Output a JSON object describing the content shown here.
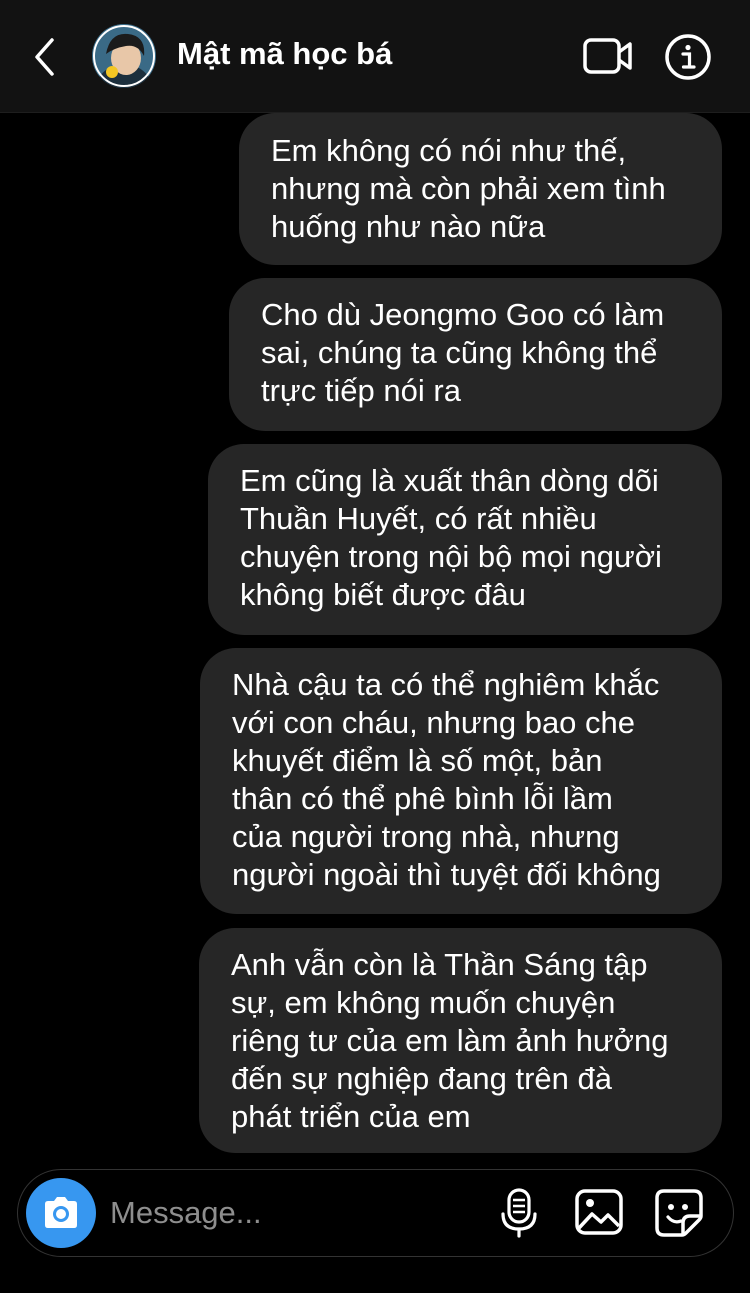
{
  "header": {
    "title": "Mật mã học bá",
    "back_icon": "chevron-left-icon",
    "video_icon": "video-camera-icon",
    "info_icon": "info-icon"
  },
  "messages": [
    {
      "text": "Em không có nói như thế,\nnhưng mà còn phải xem tình\nhuống như nào nữa",
      "side": "right"
    },
    {
      "text": "Cho dù Jeongmo Goo có làm\nsai, chúng ta cũng không thể\ntrực tiếp nói ra",
      "side": "right"
    },
    {
      "text": "Em cũng là xuất thân dòng dõi\nThuần Huyết, có rất nhiều\nchuyện trong nội bộ mọi người\nkhông biết được đâu",
      "side": "right"
    },
    {
      "text": "Nhà cậu ta có thể nghiêm khắc\nvới con cháu, nhưng bao che\nkhuyết điểm là số một, bản\nthân có thể phê bình lỗi lầm\ncủa người trong nhà, nhưng\nngười ngoài thì tuyệt đối không",
      "side": "right"
    },
    {
      "text": "Anh vẫn còn là Thần Sáng tập\nsự, em không muốn chuyện\nriêng tư của em làm ảnh hưởng\nđến sự nghiệp đang trên đà\nphát triển của em",
      "side": "right"
    }
  ],
  "composer": {
    "placeholder": "Message...",
    "value": "",
    "camera_icon": "camera-icon",
    "mic_icon": "microphone-icon",
    "gallery_icon": "image-gallery-icon",
    "sticker_icon": "sticker-icon"
  },
  "colors": {
    "background": "#000000",
    "header_bg": "#121212",
    "bubble_bg": "#262626",
    "accent": "#3797f0",
    "placeholder": "#8e8e8e"
  }
}
